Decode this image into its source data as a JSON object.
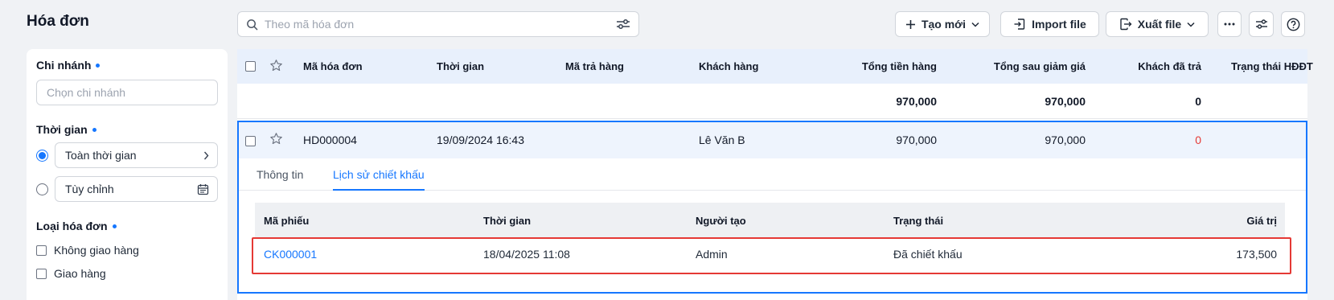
{
  "page_title": "Hóa đơn",
  "search": {
    "placeholder": "Theo mã hóa đơn"
  },
  "toolbar": {
    "create_label": "Tạo mới",
    "import_label": "Import file",
    "export_label": "Xuất file"
  },
  "sidebar": {
    "branch": {
      "title": "Chi nhánh",
      "placeholder": "Chọn chi nhánh"
    },
    "time": {
      "title": "Thời gian",
      "all_time": "Toàn thời gian",
      "custom": "Tùy chỉnh"
    },
    "invoice_type": {
      "title": "Loại hóa đơn",
      "options": [
        "Không giao hàng",
        "Giao hàng"
      ]
    }
  },
  "table": {
    "columns": [
      "Mã hóa đơn",
      "Thời gian",
      "Mã trả hàng",
      "Khách hàng",
      "Tổng tiền hàng",
      "Tổng sau giảm giá",
      "Khách đã trả",
      "Trạng thái HĐĐT"
    ],
    "summary": {
      "total_goods": "970,000",
      "total_after_discount": "970,000",
      "customer_paid": "0"
    },
    "rows": [
      {
        "invoice_code": "HD000004",
        "time": "19/09/2024 16:43",
        "return_code": "",
        "customer": "Lê Văn B",
        "total_goods": "970,000",
        "total_after_discount": "970,000",
        "customer_paid": "0"
      }
    ]
  },
  "detail": {
    "tabs": [
      "Thông tin",
      "Lịch sử chiết khấu"
    ],
    "active_tab": "Lịch sử chiết khấu",
    "columns": [
      "Mã phiếu",
      "Thời gian",
      "Người tạo",
      "Trạng thái",
      "Giá trị"
    ],
    "rows": [
      {
        "code": "CK000001",
        "time": "18/04/2025 11:08",
        "creator": "Admin",
        "status": "Đã chiết khấu",
        "value": "173,500"
      }
    ]
  },
  "colors": {
    "accent": "#1677ff",
    "highlight": "#e53935",
    "header_bg": "#e8f0fc"
  }
}
